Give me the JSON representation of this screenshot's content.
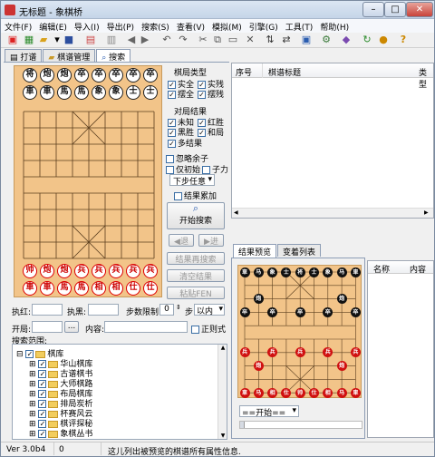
{
  "window": {
    "title": "无标题 - 象棋桥"
  },
  "menu": [
    "文件(F)",
    "编辑(E)",
    "导入(I)",
    "导出(P)",
    "搜索(S)",
    "查看(V)",
    "模拟(M)",
    "引擎(G)",
    "工具(T)",
    "帮助(H)"
  ],
  "tabs": {
    "items": [
      "打谱",
      "棋谱管理",
      "搜索"
    ],
    "active": 2
  },
  "board": {
    "top_row1": [
      "将",
      "炮",
      "炮",
      "卒",
      "卒",
      "卒",
      "卒",
      "卒"
    ],
    "top_row2": [
      "車",
      "車",
      "馬",
      "馬",
      "象",
      "象",
      "士",
      "士"
    ],
    "bottom_row1": [
      "帅",
      "炮",
      "炮",
      "兵",
      "兵",
      "兵",
      "兵",
      "兵"
    ],
    "bottom_row2": [
      "車",
      "車",
      "馬",
      "馬",
      "相",
      "相",
      "仕",
      "仕"
    ]
  },
  "filters": {
    "type_title": "棋局类型",
    "types": [
      "实全",
      "实残",
      "摆全",
      "摆残"
    ],
    "result_title": "对局结果",
    "results": [
      "未知",
      "红胜",
      "黑胜",
      "和局",
      "多结果"
    ],
    "ignore_rest": "忽略余子",
    "init_only": "仅初始",
    "piece_count": "子力",
    "next_move": "下步任意",
    "accumulate": "结果累加",
    "start_search": "开始搜索",
    "search_in_results": "结果再搜索",
    "clear_results": "清空结果",
    "paste_fen": "粘贴FEN",
    "back": "退",
    "forward": "进"
  },
  "form": {
    "red_label": "执红:",
    "black_label": "执黑:",
    "step_limit_label": "步数限制:",
    "step_limit_value": "0",
    "step_unit": "步",
    "step_mode": "以内",
    "opening_label": "开局:",
    "content_label": "内容:",
    "regex": "正则式",
    "search_scope": "搜索范围:",
    "browse": "..."
  },
  "tree": {
    "root": "棋库",
    "items": [
      "华山棋库",
      "古谱棋书",
      "大师棋路",
      "布局棋库",
      "排局炭析",
      "杯赛风云",
      "棋评探秘",
      "象棋丛书"
    ]
  },
  "results_list": {
    "columns": [
      "序号",
      "棋谱标题",
      "类型"
    ]
  },
  "bottom_tabs": {
    "items": [
      "结果预览",
      "变着列表"
    ],
    "active": 0
  },
  "preview": {
    "move_select": "==开始=="
  },
  "props": {
    "columns": [
      "名称",
      "内容"
    ]
  },
  "status": {
    "version": "Ver 3.0b4",
    "count": "0",
    "message": "这儿列出被预览的棋谱所有属性信息."
  }
}
